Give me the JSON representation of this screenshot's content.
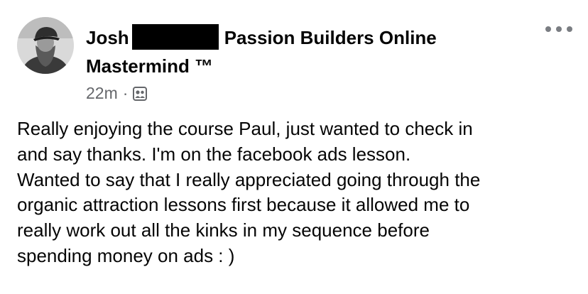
{
  "post": {
    "author_first": "Josh",
    "group_name": "Passion Builders Online",
    "group_name_line2": "Mastermind ™",
    "timestamp": "22m",
    "separator": "·",
    "audience_icon": "group-icon",
    "more_icon": "more-horizontal-icon",
    "body_lines": [
      "Really enjoying the course Paul, just wanted to check in",
      "and say thanks.  I'm on the facebook ads lesson.",
      "Wanted to say that I really appreciated going through the",
      "organic attraction lessons first because it allowed me to",
      "really work out all the kinks in my sequence before",
      "spending money on ads : )"
    ]
  },
  "colors": {
    "text": "#050505",
    "secondary_text": "#65676b",
    "redaction": "#000000"
  }
}
